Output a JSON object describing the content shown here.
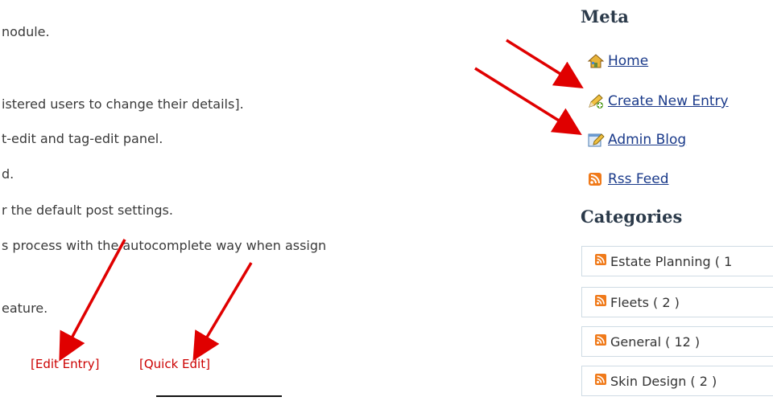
{
  "content": {
    "lines": [
      "nodule.",
      "istered users to change their details].",
      "t-edit and tag-edit panel.",
      "d.",
      "r the default post settings.",
      "s process with the autocomplete way when assign",
      "eature."
    ],
    "edit_entry": "[Edit Entry]",
    "quick_edit": "[Quick Edit]"
  },
  "sidebar": {
    "meta_title": "Meta",
    "meta_items": [
      {
        "label": "Home",
        "icon": "home-icon"
      },
      {
        "label": "Create New Entry",
        "icon": "pencil-icon"
      },
      {
        "label": "Admin Blog",
        "icon": "edit-document-icon"
      },
      {
        "label": "Rss Feed",
        "icon": "rss-icon"
      }
    ],
    "categories_title": "Categories",
    "categories": [
      {
        "label": "Estate Planning ( 1",
        "icon": "rss-icon"
      },
      {
        "label": "Fleets ( 2 )",
        "icon": "rss-icon"
      },
      {
        "label": "General ( 12 )",
        "icon": "rss-icon"
      },
      {
        "label": "Skin Design ( 2 )",
        "icon": "rss-icon"
      }
    ]
  },
  "colors": {
    "link": "#1a3a8a",
    "edit_link": "#cc0000",
    "arrow": "#e00000",
    "rss": "#f07a1a",
    "border": "#cfdbe4"
  }
}
